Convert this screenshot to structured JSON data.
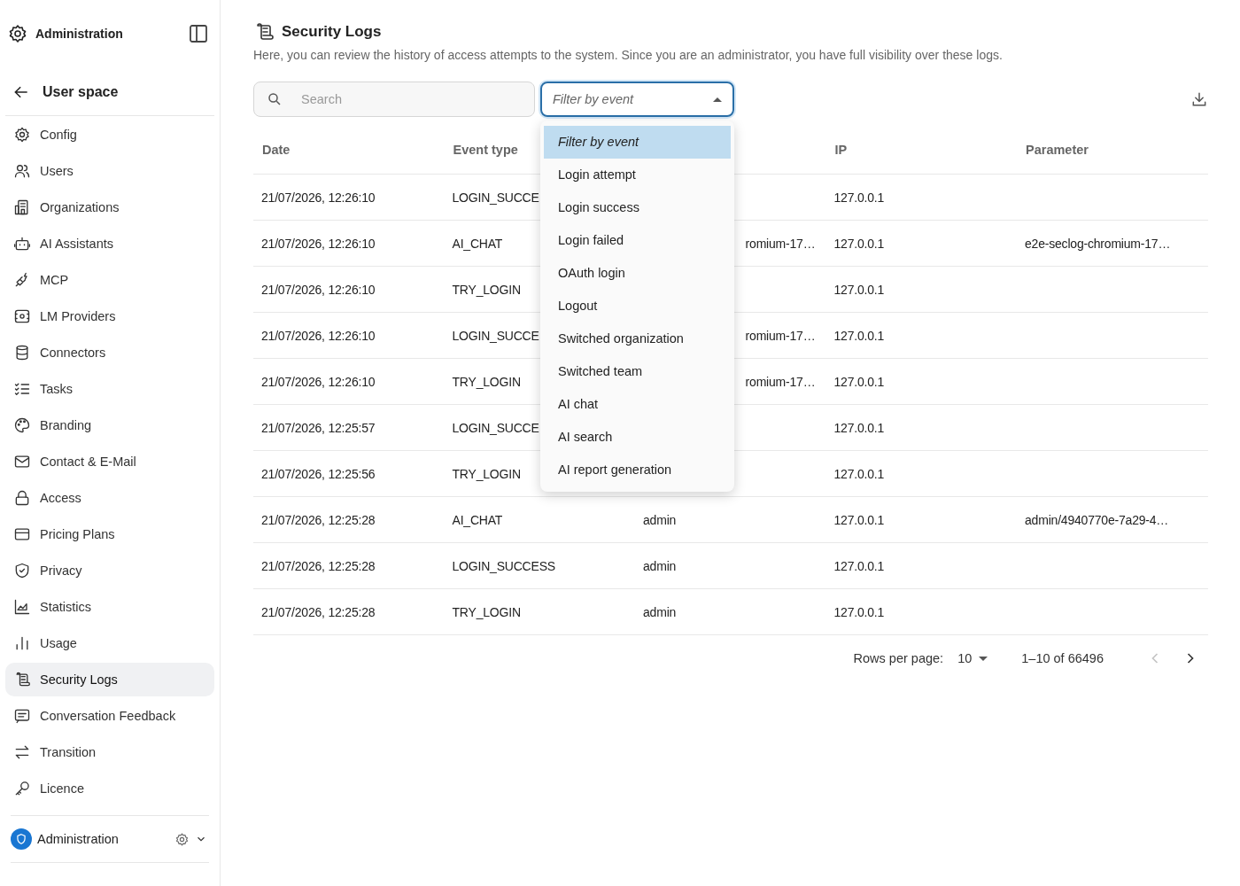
{
  "sidebar": {
    "header": {
      "title": "Administration"
    },
    "back": {
      "label": "User space"
    },
    "items": [
      {
        "label": "Config",
        "selected": false
      },
      {
        "label": "Users",
        "selected": false
      },
      {
        "label": "Organizations",
        "selected": false
      },
      {
        "label": "AI Assistants",
        "selected": false
      },
      {
        "label": "MCP",
        "selected": false
      },
      {
        "label": "LM Providers",
        "selected": false
      },
      {
        "label": "Connectors",
        "selected": false
      },
      {
        "label": "Tasks",
        "selected": false
      },
      {
        "label": "Branding",
        "selected": false
      },
      {
        "label": "Contact & E-Mail",
        "selected": false
      },
      {
        "label": "Access",
        "selected": false
      },
      {
        "label": "Pricing Plans",
        "selected": false
      },
      {
        "label": "Privacy",
        "selected": false
      },
      {
        "label": "Statistics",
        "selected": false
      },
      {
        "label": "Usage",
        "selected": false
      },
      {
        "label": "Security Logs",
        "selected": true
      },
      {
        "label": "Conversation Feedback",
        "selected": false
      },
      {
        "label": "Transition",
        "selected": false
      },
      {
        "label": "Licence",
        "selected": false
      }
    ],
    "footer": {
      "label": "Administration"
    }
  },
  "page": {
    "title": "Security Logs",
    "description": "Here, you can review the history of access attempts to the system. Since you are an administrator, you have full visibility over these logs."
  },
  "search": {
    "placeholder": "Search"
  },
  "event_filter": {
    "placeholder": "Filter by event",
    "expanded": true,
    "options": [
      {
        "label": "Filter by event",
        "kind": "placeholder",
        "selected": true
      },
      {
        "label": "Login attempt",
        "kind": "option",
        "selected": false
      },
      {
        "label": "Login success",
        "kind": "option",
        "selected": false
      },
      {
        "label": "Login failed",
        "kind": "option",
        "selected": false
      },
      {
        "label": "OAuth login",
        "kind": "option",
        "selected": false
      },
      {
        "label": "Logout",
        "kind": "option",
        "selected": false
      },
      {
        "label": "Switched organization",
        "kind": "option",
        "selected": false
      },
      {
        "label": "Switched team",
        "kind": "option",
        "selected": false
      },
      {
        "label": "AI chat",
        "kind": "option",
        "selected": false
      },
      {
        "label": "AI search",
        "kind": "option",
        "selected": false
      },
      {
        "label": "AI report generation",
        "kind": "option",
        "selected": false
      }
    ]
  },
  "table": {
    "headers": {
      "date": "Date",
      "event_type": "Event type",
      "ip": "IP",
      "parameter": "Parameter"
    },
    "rows": [
      {
        "date": "21/07/2026, 12:26:10",
        "event_type": "LOGIN_SUCCE",
        "ip": "127.0.0.1"
      },
      {
        "date": "21/07/2026, 12:26:10",
        "event_type": "AI_CHAT",
        "column_3": {
          "text": "romium-17…",
          "cut_off": true
        },
        "ip": "127.0.0.1",
        "parameter": "e2e-seclog-chromium-17…"
      },
      {
        "date": "21/07/2026, 12:26:10",
        "event_type": "TRY_LOGIN",
        "ip": "127.0.0.1"
      },
      {
        "date": "21/07/2026, 12:26:10",
        "event_type": "LOGIN_SUCCE",
        "column_3": {
          "text": "romium-17…",
          "cut_off": true
        },
        "ip": "127.0.0.1"
      },
      {
        "date": "21/07/2026, 12:26:10",
        "event_type": "TRY_LOGIN",
        "column_3": {
          "text": "romium-17…",
          "cut_off": true
        },
        "ip": "127.0.0.1"
      },
      {
        "date": "21/07/2026, 12:25:57",
        "event_type": "LOGIN_SUCCE",
        "ip": "127.0.0.1"
      },
      {
        "date": "21/07/2026, 12:25:56",
        "event_type": "TRY_LOGIN",
        "ip": "127.0.0.1"
      },
      {
        "date": "21/07/2026, 12:25:28",
        "event_type": "AI_CHAT",
        "column_3": {
          "text": "admin",
          "cut_off": false
        },
        "ip": "127.0.0.1",
        "parameter": "admin/4940770e-7a29-4…"
      },
      {
        "date": "21/07/2026, 12:25:28",
        "event_type": "LOGIN_SUCCESS",
        "column_3": {
          "text": "admin",
          "cut_off": false
        },
        "ip": "127.0.0.1"
      },
      {
        "date": "21/07/2026, 12:25:28",
        "event_type": "TRY_LOGIN",
        "column_3": {
          "text": "admin",
          "cut_off": false
        },
        "ip": "127.0.0.1"
      }
    ]
  },
  "pagination": {
    "rows_per_page_label": "Rows per page:",
    "rows_per_page": "10",
    "range": "1–10 of 66496",
    "previous_disabled": true,
    "next_disabled": false
  }
}
